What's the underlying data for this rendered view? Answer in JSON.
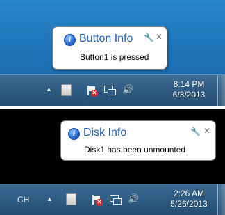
{
  "screens": [
    {
      "balloon": {
        "title": "Button Info",
        "message": "Button1 is pressed"
      },
      "tray": {
        "time": "8:14 PM",
        "date": "6/3/2013"
      }
    },
    {
      "balloon": {
        "title": "Disk Info",
        "message": "Disk1 has been unmounted"
      },
      "tray": {
        "language": "CH",
        "time": "2:26 AM",
        "date": "5/26/2013"
      }
    }
  ],
  "icons": {
    "info": "info-icon",
    "options": "wrench-icon",
    "close": "close-icon",
    "overflow": "up-arrow-icon",
    "usb": "usb-device-icon",
    "action_center": "action-center-flag-icon",
    "network": "network-icon",
    "volume": "speaker-icon"
  },
  "colors": {
    "balloon_title": "#1f5fb3",
    "taskbar": "#2e5a80",
    "desktop_top": "#1f74b8",
    "desktop_bottom": "#000000"
  }
}
